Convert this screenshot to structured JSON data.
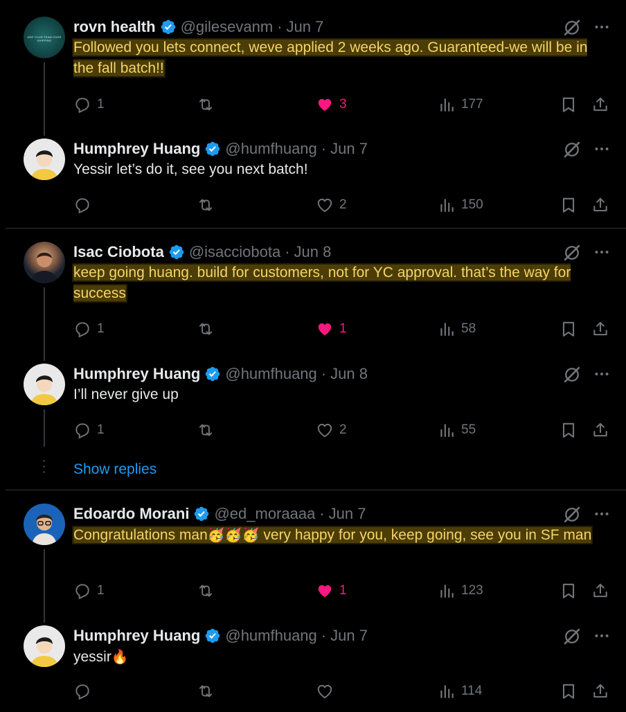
{
  "tweets": [
    {
      "name": "rovn health",
      "handle": "@gilesevanm",
      "date": "Jun 7",
      "text": "Followed you lets connect, weve applied 2 weeks ago. Guaranteed-we will be in the fall batch!!",
      "avatar_text": "ARE YOUR TEAM OVER SHIPPING",
      "replies": "1",
      "retweets": "",
      "likes": "3",
      "views": "177",
      "liked": true
    },
    {
      "name": "Humphrey Huang",
      "handle": "@humfhuang",
      "date": "Jun 7",
      "text": "Yessir let’s do it, see you next batch!",
      "replies": "",
      "retweets": "",
      "likes": "2",
      "views": "150",
      "liked": false
    },
    {
      "name": "Isac Ciobota",
      "handle": "@isacciobota",
      "date": "Jun 8",
      "text": "keep going huang. build for customers, not for YC approval. that’s the way for success",
      "replies": "1",
      "retweets": "",
      "likes": "1",
      "views": "58",
      "liked": true
    },
    {
      "name": "Humphrey Huang",
      "handle": "@humfhuang",
      "date": "Jun 8",
      "text": "I’ll never give up",
      "replies": "1",
      "retweets": "",
      "likes": "2",
      "views": "55",
      "liked": false
    },
    {
      "name": "Edoardo Morani",
      "handle": "@ed_moraaaa",
      "date": "Jun 7",
      "text_before": "Congratulations man",
      "text_emoji": "🥳🥳🥳",
      "text_after": " very happy for you, keep going, see you in SF man",
      "replies": "1",
      "retweets": "",
      "likes": "1",
      "views": "123",
      "liked": true
    },
    {
      "name": "Humphrey Huang",
      "handle": "@humfhuang",
      "date": "Jun 7",
      "text_before": "yessir",
      "text_emoji": "🔥",
      "replies": "",
      "retweets": "",
      "likes": "",
      "views": "114",
      "liked": false
    }
  ],
  "show_replies": "Show replies",
  "colors": {
    "background": "#000000",
    "text": "#e7e9ea",
    "muted": "#71767b",
    "like": "#f91880",
    "link": "#1d9bf0",
    "verified": "#1d9bf0",
    "highlight": "#f4d46a"
  }
}
